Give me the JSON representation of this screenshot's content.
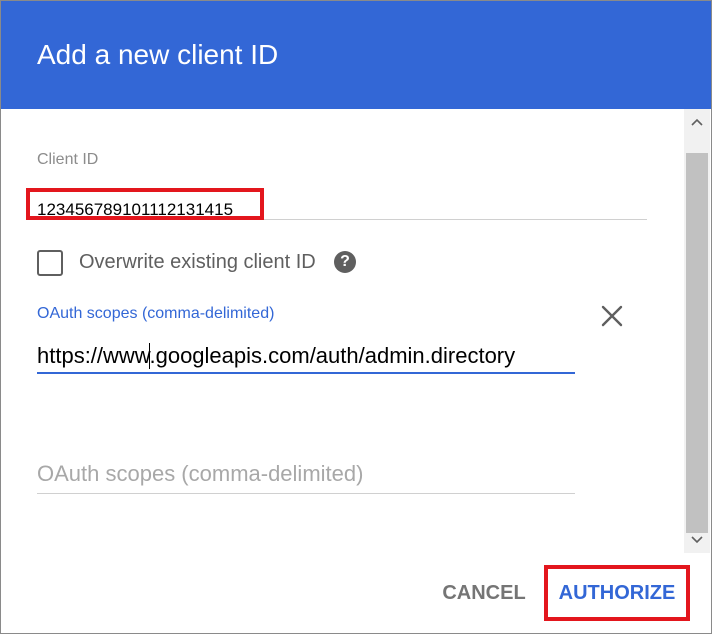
{
  "dialog": {
    "title": "Add a new client ID",
    "header_color": "#3367d6"
  },
  "client_id": {
    "label": "Client ID",
    "value": "12345678910111213141​5"
  },
  "overwrite": {
    "label": "Overwrite existing client ID",
    "checked": false,
    "help_icon": "help-circle-icon"
  },
  "oauth_scopes": {
    "label": "OAuth scopes (comma-delimited)",
    "value": "https://www.googleapis.com/auth/admin.directory",
    "clear_icon": "close-icon"
  },
  "oauth_scopes_2": {
    "placeholder": "OAuth scopes (comma-delimited)",
    "value": ""
  },
  "actions": {
    "cancel_label": "CANCEL",
    "authorize_label": "AUTHORIZE"
  },
  "scrollbar": {
    "up_icon": "triangle-up-icon",
    "down_icon": "triangle-down-icon"
  },
  "annotations": {
    "highlight_color": "#e3161d"
  }
}
